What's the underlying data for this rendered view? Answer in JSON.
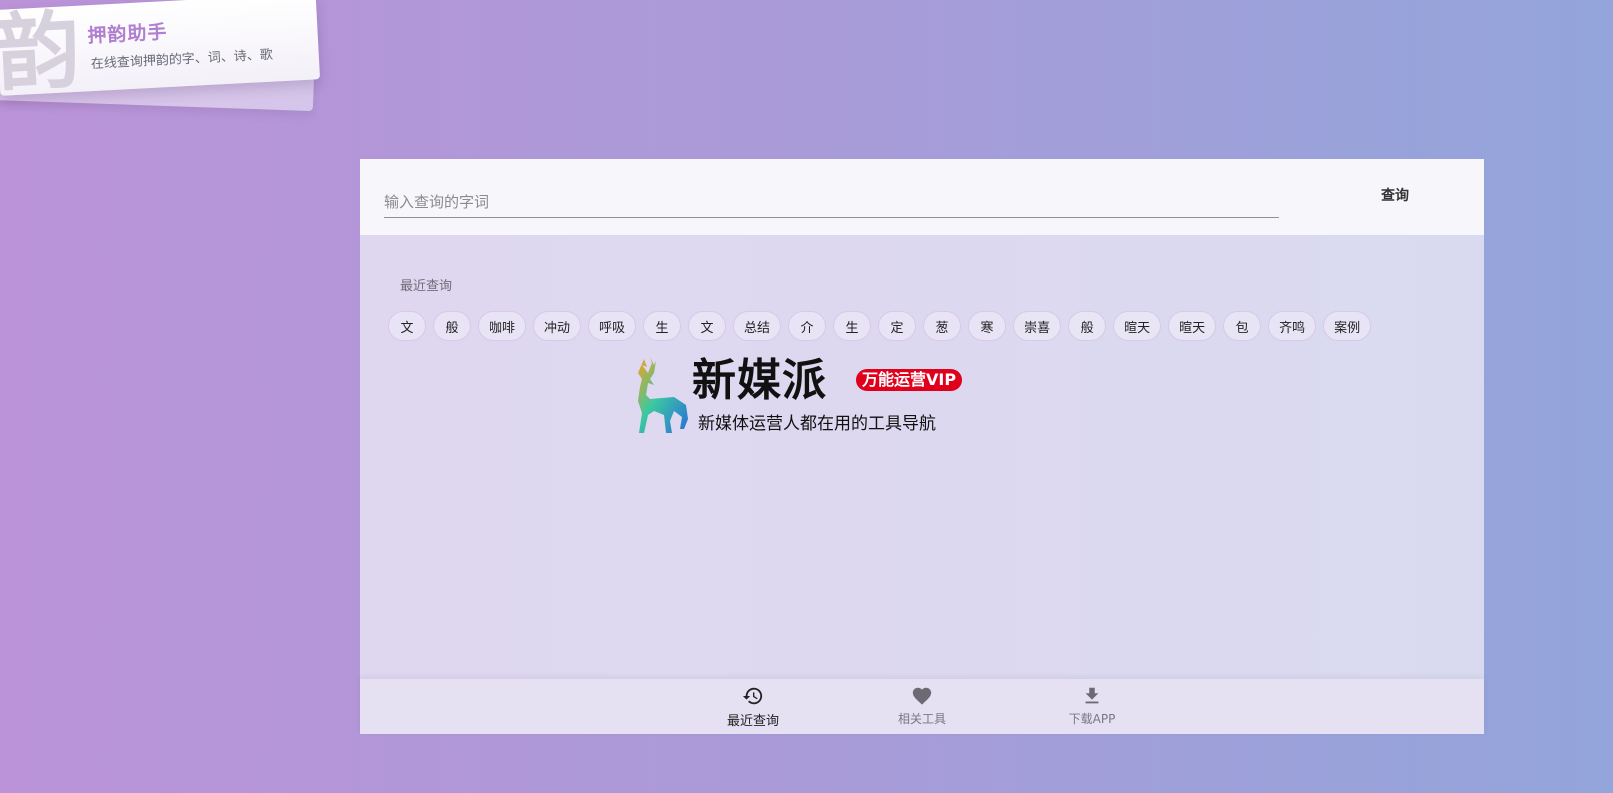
{
  "logo": {
    "glyph": "韵",
    "title": "押韵助手",
    "subtitle": "在线查询押韵的字、词、诗、歌"
  },
  "search": {
    "placeholder": "输入查询的字词",
    "value": "",
    "button_label": "查询"
  },
  "recent": {
    "label": "最近查询",
    "items": [
      "文",
      "般",
      "咖啡",
      "冲动",
      "呼吸",
      "生",
      "文",
      "总结",
      "介",
      "生",
      "定",
      "葱",
      "寒",
      "崇喜",
      "般",
      "暄天",
      "暄天",
      "包",
      "齐鸣",
      "案例"
    ]
  },
  "ad": {
    "brand": "新媒派",
    "badge": "万能运营VIP",
    "slogan": "新媒体运营人都在用的工具导航"
  },
  "bottom_nav": {
    "items": [
      {
        "label": "最近查询",
        "icon": "history-icon"
      },
      {
        "label": "相关工具",
        "icon": "heart-icon"
      },
      {
        "label": "下载APP",
        "icon": "download-icon"
      }
    ]
  },
  "colors": {
    "brand": "#b07fd0",
    "vip_badge": "#e0001c"
  }
}
